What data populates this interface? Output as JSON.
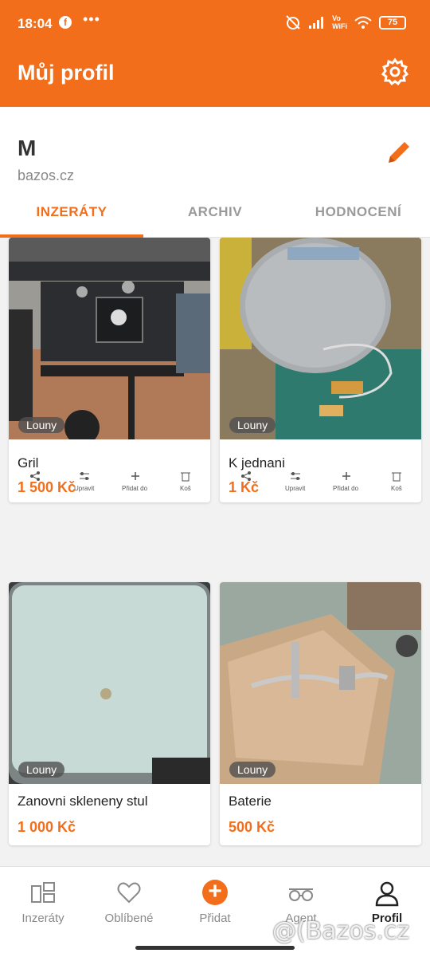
{
  "status": {
    "time": "18:04",
    "fb": "f",
    "dots": "•••",
    "vowifi_top": "Vo",
    "vowifi_bottom": "WiFi",
    "battery": "75"
  },
  "header": {
    "title": "Můj profil",
    "settings_icon": "gear-icon"
  },
  "profile": {
    "name": "M",
    "site": "bazos.cz",
    "edit_icon": "pencil-icon"
  },
  "tabs": [
    {
      "label": "INZERÁTY",
      "active": true
    },
    {
      "label": "ARCHIV",
      "active": false
    },
    {
      "label": "HODNOCENÍ",
      "active": false
    }
  ],
  "listings": [
    {
      "title": "Gril",
      "price": "1 500 Kč",
      "location": "Louny",
      "strip": [
        "Upravit",
        "Přidat do",
        "Koš"
      ]
    },
    {
      "title": "K jednani",
      "price": "1 Kč",
      "location": "Louny",
      "strip": [
        "Upravit",
        "Přidat do",
        "Koš"
      ]
    },
    {
      "title": "Zanovni skleneny stul",
      "price": "1 000 Kč",
      "location": "Louny"
    },
    {
      "title": "Baterie",
      "price": "500 Kč",
      "location": "Louny"
    }
  ],
  "nav": [
    {
      "label": "Inzeráty",
      "icon": "listings-icon",
      "active": false
    },
    {
      "label": "Oblíbené",
      "icon": "heart-icon",
      "active": false
    },
    {
      "label": "Přidat",
      "icon": "plus-icon",
      "active": false
    },
    {
      "label": "Agent",
      "icon": "glasses-icon",
      "active": false
    },
    {
      "label": "Profil",
      "icon": "person-icon",
      "active": true
    }
  ],
  "watermark": "@(Bazos.cz",
  "colors": {
    "brand": "#f26e1a"
  }
}
